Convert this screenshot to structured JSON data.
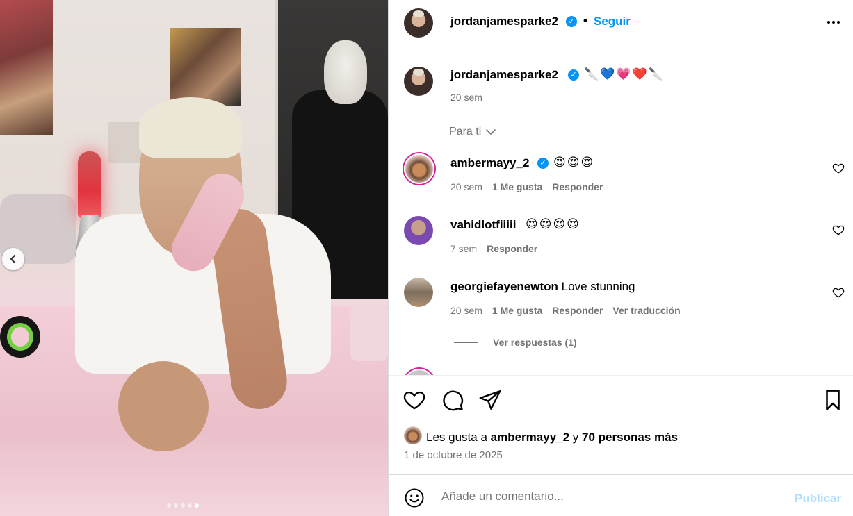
{
  "post": {
    "image_alt_icons": {
      "prev": "chevron-left-icon"
    },
    "carousel_count": 5,
    "carousel_active": 5
  },
  "header": {
    "username": "jordanjamesparke2",
    "verified": true,
    "separator": "•",
    "follow_label": "Seguir",
    "more_icon": "more-horizontal-icon"
  },
  "caption": {
    "username": "jordanjamesparke2",
    "emojis": "🔪💙💗❤️🔪",
    "time": "20 sem"
  },
  "filter": {
    "label": "Para ti"
  },
  "comments": [
    {
      "username": "ambermayy_2",
      "verified": true,
      "text": "😍😍😍",
      "time": "20 sem",
      "likes": "1 Me gusta",
      "reply": "Responder"
    },
    {
      "username": "vahidlotfiiiii",
      "verified": false,
      "text": "😍😍😍😍",
      "time": "7 sem",
      "reply": "Responder"
    },
    {
      "username": "georgiefayenewton",
      "verified": false,
      "text": "Love stunning",
      "time": "20 sem",
      "likes": "1 Me gusta",
      "reply": "Responder",
      "translate": "Ver traducción"
    }
  ],
  "view_replies": "Ver respuestas (1)",
  "actions": {
    "like_icon": "heart-icon",
    "comment_icon": "comment-icon",
    "share_icon": "send-icon",
    "save_icon": "bookmark-icon"
  },
  "likes": {
    "prefix": "Les gusta a",
    "user": "ambermayy_2",
    "connector": "y",
    "others": "70 personas más"
  },
  "date": "1 de octubre de 2025",
  "add_comment": {
    "placeholder": "Añade un comentario...",
    "publish_label": "Publicar",
    "emoji_icon": "smiley-icon"
  },
  "colors": {
    "accent": "#0095f6",
    "muted": "#737373",
    "publish_disabled": "#b2dffc"
  }
}
